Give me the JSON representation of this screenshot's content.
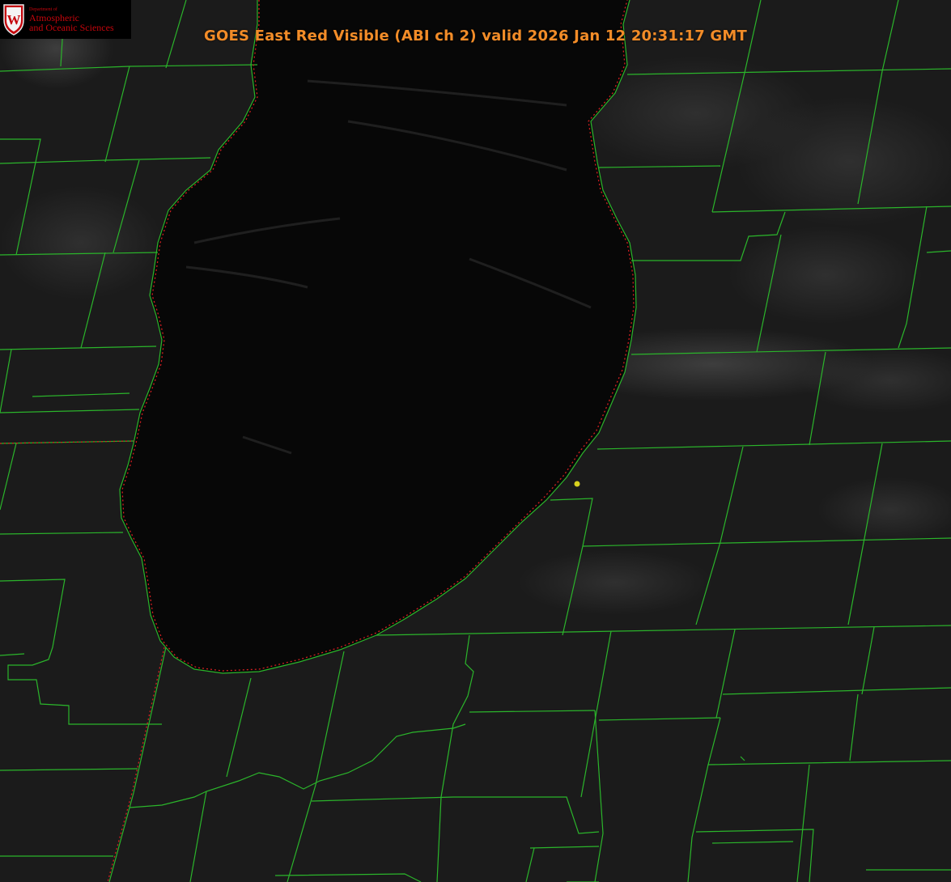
{
  "header": {
    "title": "GOES East Red Visible (ABI ch 2) valid 2026 Jan 12 20:31:17 GMT"
  },
  "logo": {
    "department": "Department of",
    "line1": "Atmospheric",
    "line2": "and Oceanic Sciences",
    "crest_letter": "W"
  },
  "colors": {
    "county_lines": "#2bb52b",
    "state_line": "#d22020",
    "lake": "#060606",
    "land": "#1a1a1a",
    "marker": "#d8d21e",
    "title": "#f28c28",
    "logo_red": "#c5050c"
  },
  "icons": {
    "logo": "uw-crest-icon",
    "marker": "location-marker-icon"
  }
}
